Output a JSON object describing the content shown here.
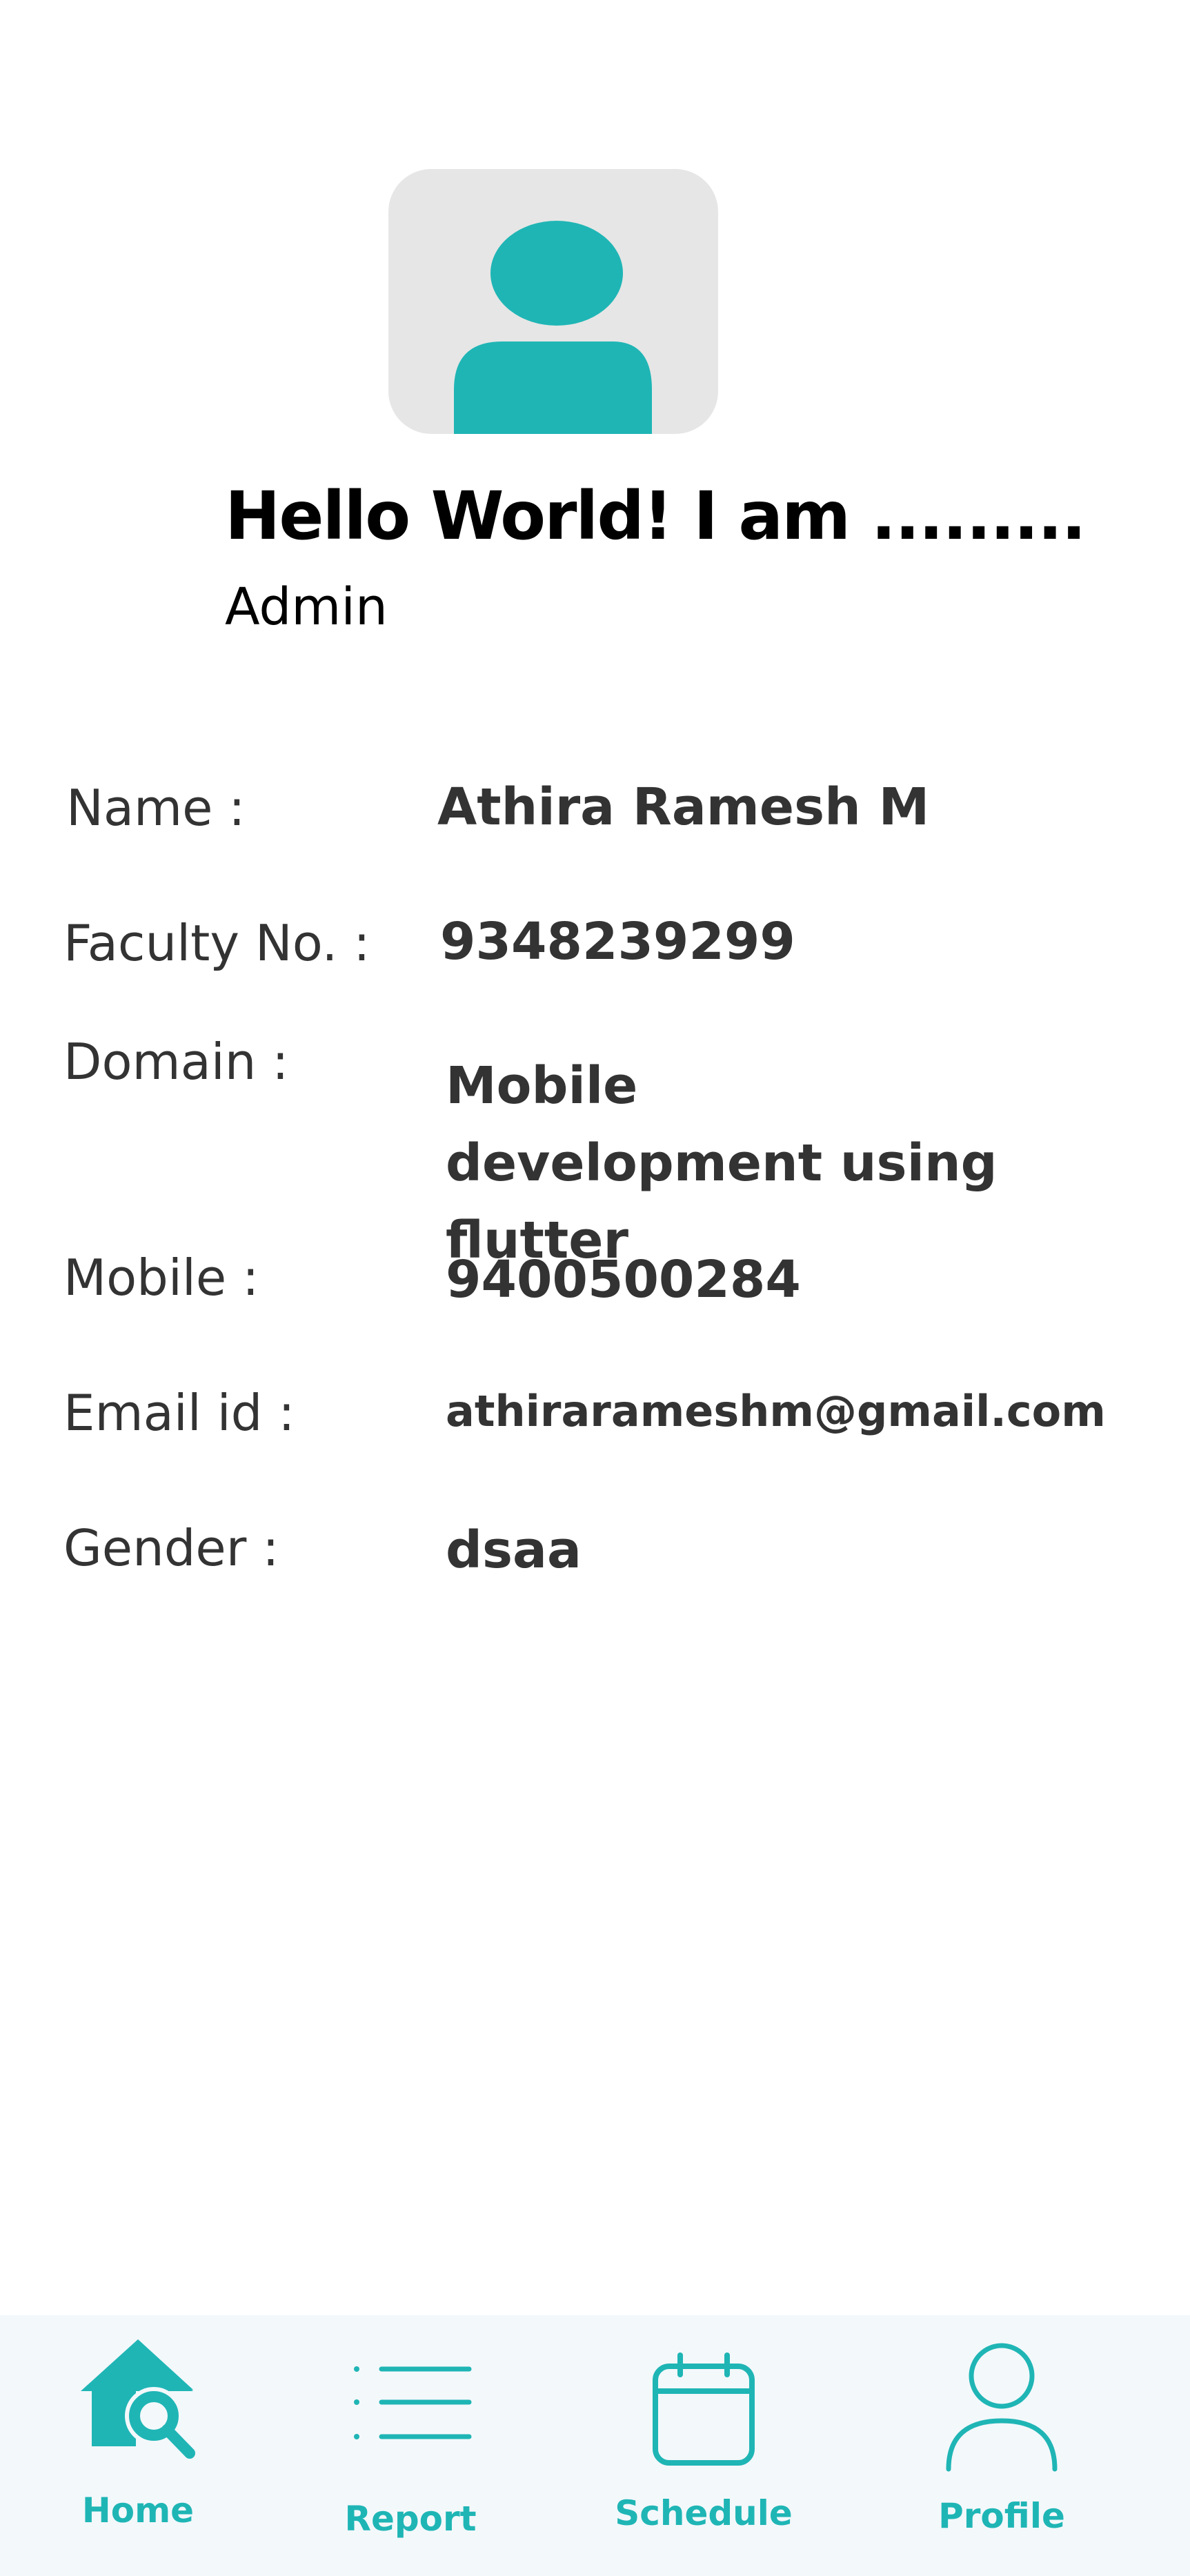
{
  "colors": {
    "accent": "#1fb5b5",
    "avatar_bg": "#e6e6e6",
    "nav_bg": "#f3f8fb",
    "text_dark": "#333333"
  },
  "header": {
    "greeting": "Hello World! I am  .........",
    "role": "Admin",
    "avatar_icon": "person-icon"
  },
  "profile": {
    "name_label": "Name :",
    "name_value": "Athira Ramesh M",
    "faculty_label": "Faculty No. :",
    "faculty_value": "9348239299",
    "domain_label": "Domain :",
    "domain_value": "Mobile development using flutter",
    "mobile_label": "Mobile :",
    "mobile_value": "9400500284",
    "email_label": "Email id :",
    "email_value": "athirarameshm@gmail.com",
    "gender_label": "Gender :",
    "gender_value": "dsaa"
  },
  "nav": {
    "items": [
      {
        "label": "Home",
        "icon": "home-search-icon",
        "active": true
      },
      {
        "label": "Report",
        "icon": "list-icon",
        "active": false
      },
      {
        "label": "Schedule",
        "icon": "calendar-icon",
        "active": false
      },
      {
        "label": "Profile",
        "icon": "person-outline-icon",
        "active": false
      }
    ]
  }
}
